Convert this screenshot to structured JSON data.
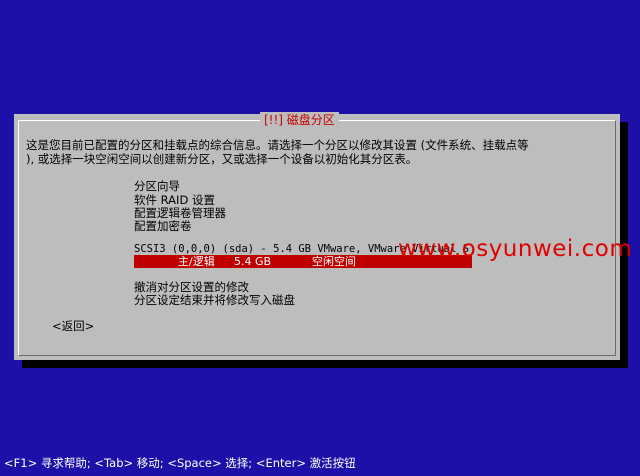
{
  "dialog": {
    "title": "[!!] 磁盘分区",
    "description_line1": "这是您目前已配置的分区和挂载点的综合信息。请选择一个分区以修改其设置 (文件系统、挂载点等",
    "description_line2": "), 或选择一块空闲空间以创建新分区，又或选择一个设备以初始化其分区表。",
    "menu_items": [
      "分区向导",
      "软件 RAID 设置",
      "配置逻辑卷管理器",
      "配置加密卷"
    ],
    "disk_line": "SCSI3 (0,0,0) (sda) - 5.4 GB VMware, VMware Virtual S",
    "partition": {
      "type": "主/逻辑",
      "size": "5.4 GB",
      "fs": "空闲空间"
    },
    "undo_label": "撤消对分区设置的修改",
    "finish_label": "分区设定结束并将修改写入磁盘",
    "back_label": "<返回>"
  },
  "watermark": "www.osyunwei.com",
  "help_bar": "<F1> 寻求帮助; <Tab> 移动; <Space> 选择; <Enter> 激活按钮",
  "colors": {
    "background": "#1c10a8",
    "dialog": "#bdbdbd",
    "highlight": "#c00000",
    "title": "#c80000"
  }
}
